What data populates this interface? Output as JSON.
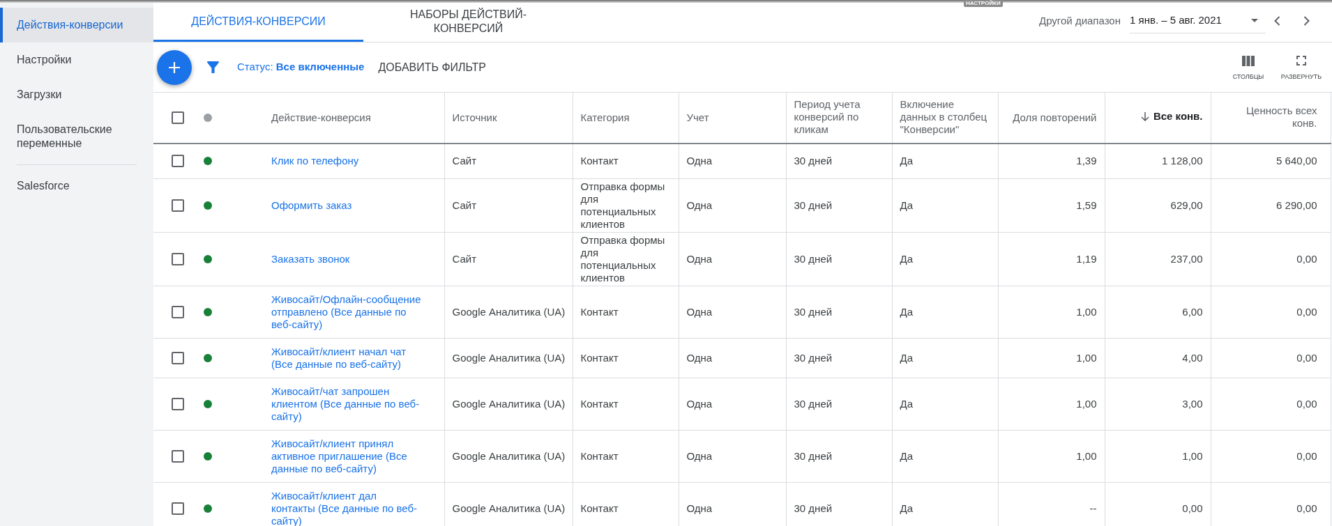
{
  "top_label": {
    "text": "НАСТРОЙКИ"
  },
  "sidebar": {
    "sections": [
      {
        "items": [
          {
            "label": "Действия-конверсии",
            "selected": true
          },
          {
            "label": "Настройки",
            "selected": false
          },
          {
            "label": "Загрузки",
            "selected": false
          },
          {
            "label": "Пользовательские переменные",
            "selected": false
          }
        ]
      },
      {
        "items": [
          {
            "label": "Salesforce",
            "selected": false
          }
        ]
      }
    ]
  },
  "tabs": [
    {
      "label": "ДЕЙСТВИЯ-КОНВЕРСИИ",
      "selected": true
    },
    {
      "label": "НАБОРЫ ДЕЙСТВИЙ-КОНВЕРСИЙ",
      "selected": false
    }
  ],
  "date_range": {
    "label": "Другой диапазон",
    "value": "1 янв. – 5 авг. 2021"
  },
  "toolbar": {
    "status_filter": "Статус: **Все включенные**",
    "add_filter": "ДОБАВИТЬ ФИЛЬТР",
    "actions": [
      {
        "kind": "columns",
        "label": "СТОЛБЦЫ"
      },
      {
        "kind": "expand",
        "label": "РАЗВЕРНУТЬ"
      }
    ]
  },
  "table": {
    "all_checked": false,
    "columns": [
      {
        "label": "Действие-конверсия",
        "kind": "link",
        "sorted": false
      },
      {
        "label": "Источник",
        "kind": "text",
        "sorted": false
      },
      {
        "label": "Категория",
        "kind": "text",
        "sorted": false
      },
      {
        "label": "Учет",
        "kind": "text",
        "sorted": false
      },
      {
        "label": "Период учета конверсий по кликам",
        "kind": "text",
        "sorted": false
      },
      {
        "label": "Включение данных в столбец \"Конверсии\"",
        "kind": "text",
        "sorted": false
      },
      {
        "label": "Доля повторений",
        "kind": "number",
        "sorted": false
      },
      {
        "label": "Все конв.",
        "kind": "number",
        "sorted": true
      },
      {
        "label": "Ценность всех конв.",
        "kind": "number",
        "sorted": false
      }
    ],
    "rows": [
      {
        "checked": false,
        "enabled": true,
        "cells": [
          "Клик по телефону",
          "Сайт",
          "Контакт",
          "Одна",
          "30 дней",
          "Да",
          "1,39",
          "1 128,00",
          "5 640,00"
        ]
      },
      {
        "checked": false,
        "enabled": true,
        "cells": [
          "Оформить заказ",
          "Сайт",
          "Отправка формы для потенциальных клиентов",
          "Одна",
          "30 дней",
          "Да",
          "1,59",
          "629,00",
          "6 290,00"
        ]
      },
      {
        "checked": false,
        "enabled": true,
        "cells": [
          "Заказать звонок",
          "Сайт",
          "Отправка формы для потенциальных клиентов",
          "Одна",
          "30 дней",
          "Да",
          "1,19",
          "237,00",
          "0,00"
        ]
      },
      {
        "checked": false,
        "enabled": true,
        "cells": [
          "Живосайт/Офлайн-сообщение отправлено (Все данные по веб-сайту)",
          "Google Аналитика (UA)",
          "Контакт",
          "Одна",
          "30 дней",
          "Да",
          "1,00",
          "6,00",
          "0,00"
        ]
      },
      {
        "checked": false,
        "enabled": true,
        "cells": [
          "Живосайт/клиент начал чат (Все данные по веб-сайту)",
          "Google Аналитика (UA)",
          "Контакт",
          "Одна",
          "30 дней",
          "Да",
          "1,00",
          "4,00",
          "0,00"
        ]
      },
      {
        "checked": false,
        "enabled": true,
        "cells": [
          "Живосайт/чат запрошен клиентом (Все данные по веб-сайту)",
          "Google Аналитика (UA)",
          "Контакт",
          "Одна",
          "30 дней",
          "Да",
          "1,00",
          "3,00",
          "0,00"
        ]
      },
      {
        "checked": false,
        "enabled": true,
        "cells": [
          "Живосайт/клиент принял активное приглашение (Все данные по веб-сайту)",
          "Google Аналитика (UA)",
          "Контакт",
          "Одна",
          "30 дней",
          "Да",
          "1,00",
          "1,00",
          "0,00"
        ]
      },
      {
        "checked": false,
        "enabled": true,
        "cells": [
          "Живосайт/клиент дал контакты (Все данные по веб-сайту)",
          "Google Аналитика (UA)",
          "Контакт",
          "Одна",
          "30 дней",
          "Да",
          "--",
          "0,00",
          "0,00"
        ]
      }
    ]
  }
}
